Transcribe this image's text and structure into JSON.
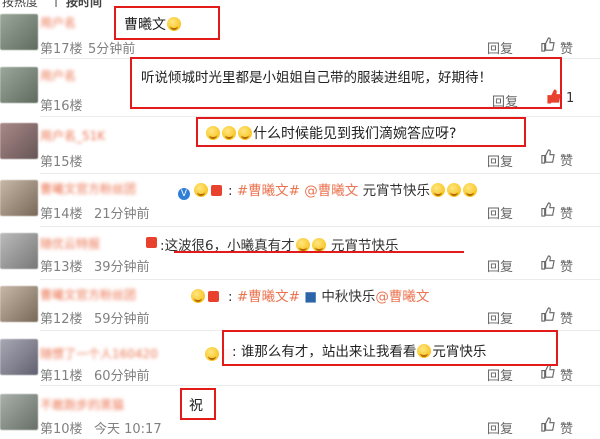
{
  "top_tabs": {
    "hot": "按热度",
    "divider": "|",
    "time": "按时间"
  },
  "reply_label": "回复",
  "like_label": "赞",
  "comments": [
    {
      "user": "用户名",
      "floor": "第17楼",
      "time": "5分钟前",
      "text": "曹曦文"
    },
    {
      "user": "用户名",
      "floor": "第16楼",
      "time": "",
      "text": "听说倾城时光里都是小姐姐自己带的服装进组呢，好期待！",
      "likes": "1"
    },
    {
      "user": "用户名_51K",
      "floor": "第15楼",
      "time": "",
      "text": "什么时候能见到我们滴婉答应呀?"
    },
    {
      "user": "曹曦文官方粉丝团",
      "floor": "第14楼",
      "time": "21分钟前",
      "tag1": "#曹曦文#",
      "mention": "@曹曦文",
      "text": "元宵节快乐"
    },
    {
      "user": "随优云特报",
      "floor": "第13楼",
      "time": "39分钟前",
      "text": "这波很6，小曦真有才",
      "text2": "元宵节快乐"
    },
    {
      "user": "曹曦文官方粉丝团",
      "floor": "第12楼",
      "time": "59分钟前",
      "tag1": "#曹曦文#",
      "text": "中秋快乐",
      "mention": "@曹曦文"
    },
    {
      "user": "随惯了一个人160420",
      "floor": "第11楼",
      "time": "60分钟前",
      "text": "谁那么有才，站出来让我看看",
      "text2": "元宵快乐"
    },
    {
      "user": "不敢跑步的黑猫",
      "floor": "第10楼",
      "time": "今天 10:17",
      "text": "祝"
    }
  ],
  "colors": {
    "highlight": "#e31a1a",
    "tag": "#eb7350",
    "link": "#2b64a8"
  }
}
